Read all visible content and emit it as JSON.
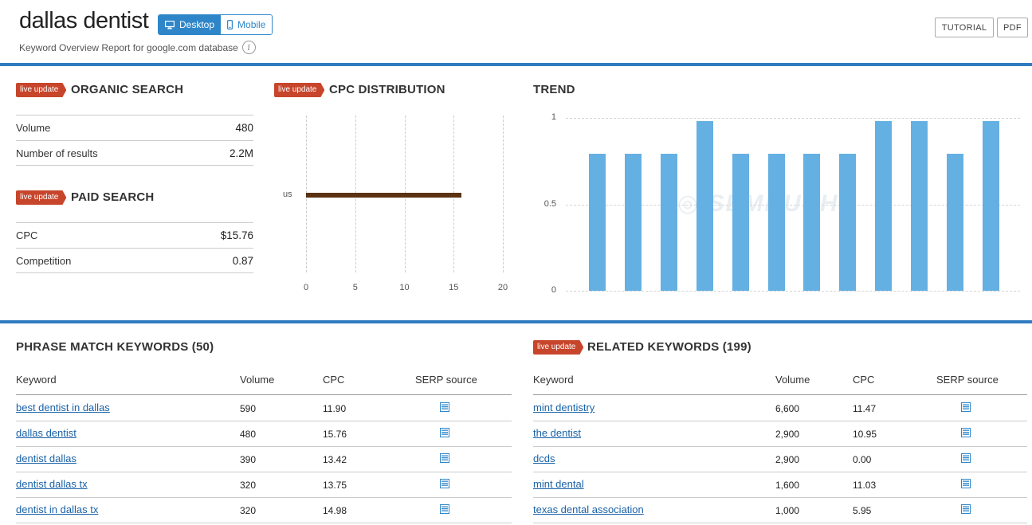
{
  "header": {
    "title": "dallas dentist",
    "device_desktop": "Desktop",
    "device_mobile": "Mobile",
    "subtitle": "Keyword Overview Report for google.com database",
    "info_glyph": "i",
    "tutorial_label": "TUTORIAL",
    "pdf_label": "PDF"
  },
  "live_badge": "live update",
  "organic": {
    "title": "ORGANIC SEARCH",
    "rows": [
      {
        "label": "Volume",
        "value": "480"
      },
      {
        "label": "Number of results",
        "value": "2.2M"
      }
    ]
  },
  "paid": {
    "title": "PAID SEARCH",
    "rows": [
      {
        "label": "CPC",
        "value": "$15.76"
      },
      {
        "label": "Competition",
        "value": "0.87"
      }
    ]
  },
  "cpc_distribution": {
    "title": "CPC DISTRIBUTION"
  },
  "trend": {
    "title": "TREND"
  },
  "chart_data": [
    {
      "type": "bar",
      "title": "CPC DISTRIBUTION",
      "orientation": "horizontal",
      "categories": [
        "us"
      ],
      "values": [
        15.76
      ],
      "xlim": [
        0,
        20
      ],
      "xticks": [
        "0",
        "5",
        "10",
        "15",
        "20"
      ],
      "grid": true,
      "color": "#5b3212"
    },
    {
      "type": "bar",
      "title": "TREND",
      "values": [
        0.81,
        0.81,
        0.81,
        1.0,
        0.81,
        0.81,
        0.81,
        0.81,
        1.0,
        1.0,
        0.81,
        1.0
      ],
      "ylim": [
        0,
        1
      ],
      "yticks": [
        "1",
        "0.5",
        "0"
      ],
      "grid": true,
      "color": "#64b0e3"
    }
  ],
  "phrase_match": {
    "title": "PHRASE MATCH KEYWORDS (50)",
    "columns": [
      "Keyword",
      "Volume",
      "CPC",
      "SERP source"
    ],
    "rows": [
      {
        "keyword": "best dentist in dallas",
        "volume": "590",
        "cpc": "11.90"
      },
      {
        "keyword": "dallas dentist",
        "volume": "480",
        "cpc": "15.76"
      },
      {
        "keyword": "dentist dallas",
        "volume": "390",
        "cpc": "13.42"
      },
      {
        "keyword": "dentist dallas tx",
        "volume": "320",
        "cpc": "13.75"
      },
      {
        "keyword": "dentist in dallas tx",
        "volume": "320",
        "cpc": "14.98"
      }
    ]
  },
  "related": {
    "title": "RELATED KEYWORDS (199)",
    "columns": [
      "Keyword",
      "Volume",
      "CPC",
      "SERP source"
    ],
    "rows": [
      {
        "keyword": "mint dentistry",
        "volume": "6,600",
        "cpc": "11.47"
      },
      {
        "keyword": "the dentist",
        "volume": "2,900",
        "cpc": "10.95"
      },
      {
        "keyword": "dcds",
        "volume": "2,900",
        "cpc": "0.00"
      },
      {
        "keyword": "mint dental",
        "volume": "1,600",
        "cpc": "11.03"
      },
      {
        "keyword": "texas dental association",
        "volume": "1,000",
        "cpc": "5.95"
      }
    ]
  },
  "colors": {
    "accent": "#2e86c9",
    "live_badge": "#c7452b",
    "link": "#1a62a8"
  }
}
